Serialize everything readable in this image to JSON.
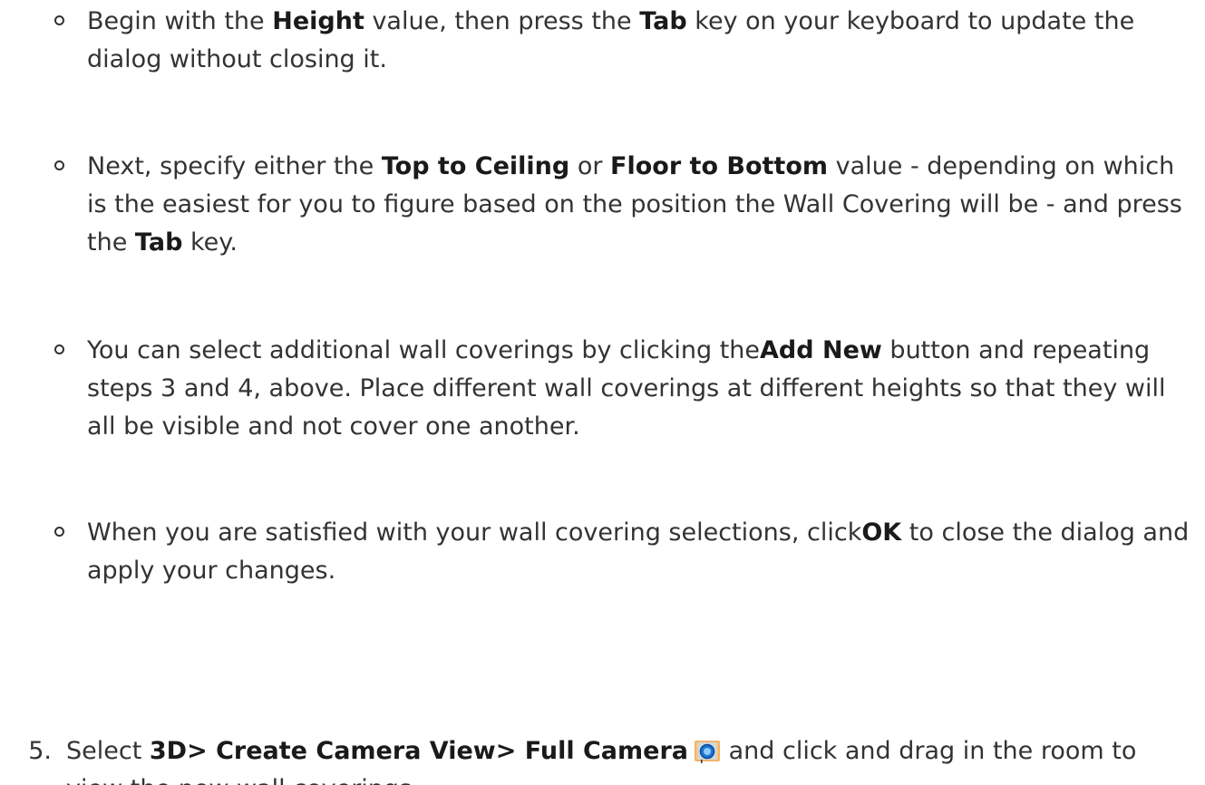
{
  "bullets": [
    {
      "parts": [
        {
          "t": "Begin with the ",
          "b": false
        },
        {
          "t": "Height",
          "b": true
        },
        {
          "t": " value, then press the ",
          "b": false
        },
        {
          "t": "Tab",
          "b": true
        },
        {
          "t": " key on your keyboard to update the dialog without closing it.",
          "b": false
        }
      ]
    },
    {
      "parts": [
        {
          "t": "Next, specify either the ",
          "b": false
        },
        {
          "t": "Top to Ceiling",
          "b": true
        },
        {
          "t": " or ",
          "b": false
        },
        {
          "t": "Floor to Bottom",
          "b": true
        },
        {
          "t": " value - depending on which is the easiest for you to figure based on the position the Wall Covering will be - and press the ",
          "b": false
        },
        {
          "t": "Tab",
          "b": true
        },
        {
          "t": " key.",
          "b": false
        }
      ]
    },
    {
      "parts": [
        {
          "t": "You can select additional wall coverings by clicking the",
          "b": false
        },
        {
          "t": "Add New",
          "b": true
        },
        {
          "t": " button and repeating steps 3 and 4, above. Place different wall coverings at different heights so that they will all be visible and not cover one another.",
          "b": false
        }
      ]
    },
    {
      "parts": [
        {
          "t": "When you are satisfied with your wall covering selections, click",
          "b": false
        },
        {
          "t": "OK",
          "b": true
        },
        {
          "t": " to close the dialog and apply your changes.",
          "b": false
        }
      ]
    }
  ],
  "step5": {
    "number": "5.",
    "parts_before_icon": [
      {
        "t": "Select ",
        "b": false
      },
      {
        "t": "3D> Create Camera View> Full Camera",
        "b": true
      }
    ],
    "icon": "camera-icon",
    "parts_after_icon": [
      {
        "t": " and click and drag in the room to view the new wall coverings.",
        "b": false
      }
    ]
  }
}
